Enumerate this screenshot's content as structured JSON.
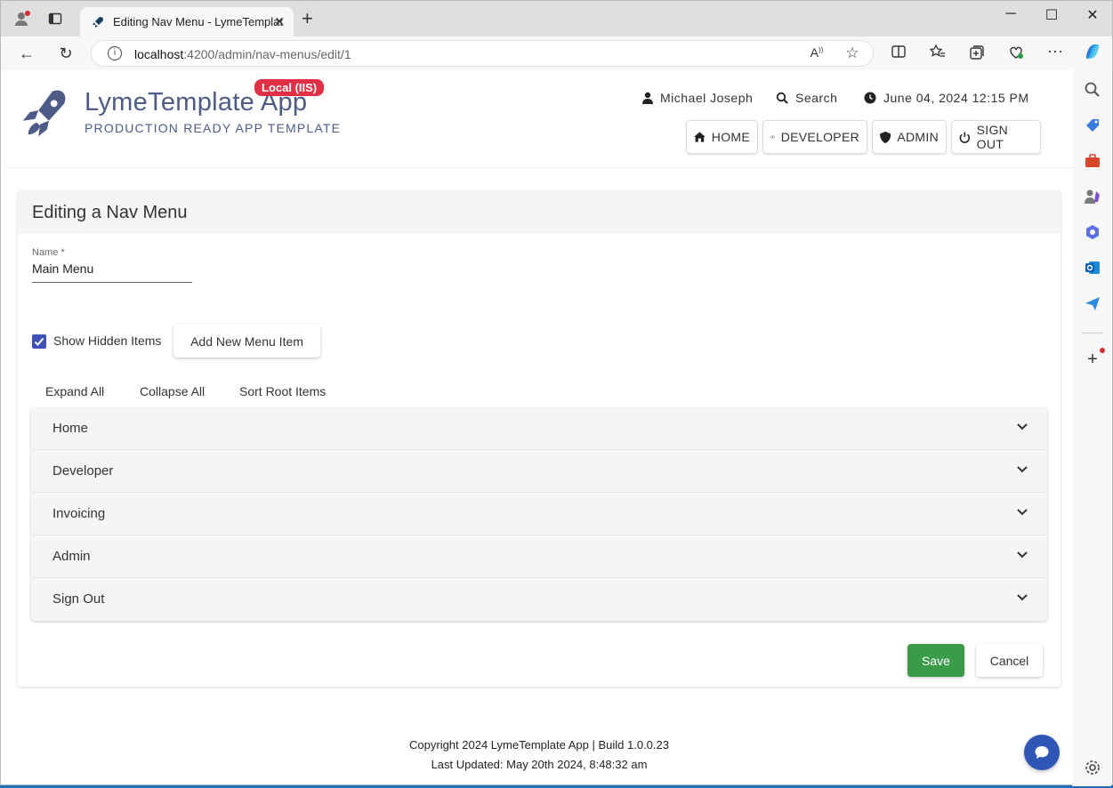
{
  "browser": {
    "tab_title": "Editing Nav Menu - LymeTemplat",
    "url_host": "localhost",
    "url_path": ":4200/admin/nav-menus/edit/1"
  },
  "header": {
    "app_title": "LymeTemplate App",
    "app_subtitle": "PRODUCTION READY APP TEMPLATE",
    "env_badge": "Local (IIS)",
    "user": "Michael Joseph",
    "search": "Search",
    "datetime": "June 04, 2024 12:15 PM",
    "nav": [
      "HOME",
      "DEVELOPER",
      "ADMIN",
      "SIGN OUT"
    ]
  },
  "card": {
    "title": "Editing a Nav Menu",
    "name_label": "Name *",
    "name_value": "Main Menu",
    "show_hidden_label": "Show Hidden Items",
    "show_hidden_checked": true,
    "add_button": "Add New Menu Item",
    "expand_all": "Expand All",
    "collapse_all": "Collapse All",
    "sort_root": "Sort Root Items",
    "items": [
      "Home",
      "Developer",
      "Invoicing",
      "Admin",
      "Sign Out"
    ],
    "save": "Save",
    "cancel": "Cancel"
  },
  "footer": {
    "line1": "Copyright 2024 LymeTemplate App | Build 1.0.0.23",
    "line2": "Last Updated: May 20th 2024, 8:48:32 am"
  },
  "colors": {
    "brand": "#4d5b86",
    "badge": "#e03045",
    "save": "#3a9c49",
    "checkbox": "#3f51b5",
    "chat": "#2f56b5"
  }
}
